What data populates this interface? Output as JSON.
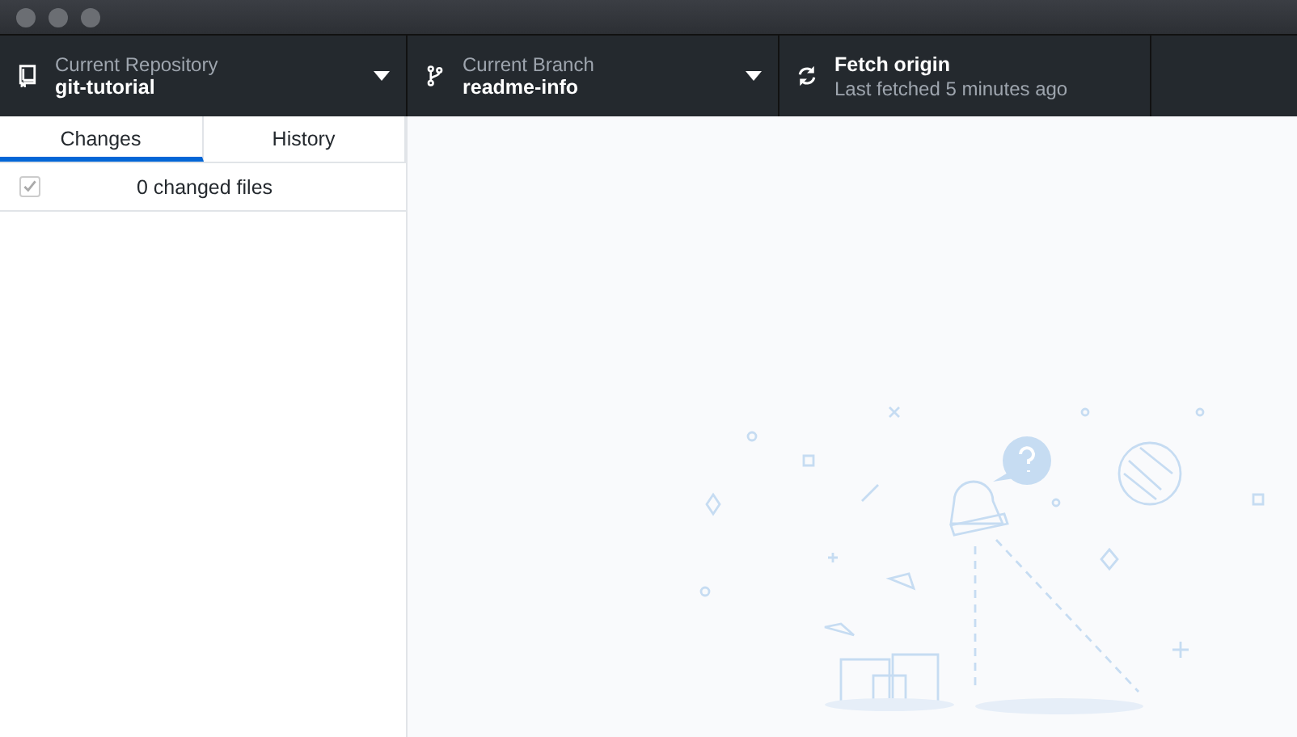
{
  "toolbar": [
    {
      "kind": "repository",
      "label": "Current Repository",
      "value": "git-tutorial"
    },
    {
      "kind": "branch",
      "label": "Current Branch",
      "value": "readme-info"
    },
    {
      "kind": "fetch",
      "label": "Fetch origin",
      "value": "Last fetched 5 minutes ago"
    }
  ],
  "tabs": [
    {
      "label": "Changes",
      "selected": true
    },
    {
      "label": "History",
      "selected": false
    }
  ],
  "changes": {
    "checked": true,
    "label": "0 changed files"
  }
}
